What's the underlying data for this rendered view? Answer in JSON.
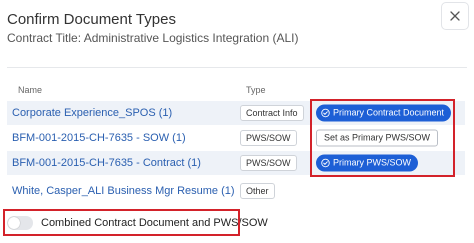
{
  "dialog": {
    "title": "Confirm Document Types",
    "subtitle": "Contract Title: Administrative Logistics Integration (ALI)",
    "close_icon": "close-icon"
  },
  "table": {
    "columns": {
      "name": "Name",
      "type": "Type"
    },
    "rows": [
      {
        "name": "Corporate Experience_SPOS (1)",
        "type": "Contract Info",
        "action": "Primary Contract Document",
        "action_style": "primary-selected"
      },
      {
        "name": "BFM-001-2015-CH-7635 - SOW (1)",
        "type": "PWS/SOW",
        "action": "Set as Primary PWS/SOW",
        "action_style": "button"
      },
      {
        "name": "BFM-001-2015-CH-7635 - Contract (1)",
        "type": "PWS/SOW",
        "action": "Primary PWS/SOW",
        "action_style": "primary-selected"
      },
      {
        "name": "White, Casper_ALI Business Mgr Resume (1)",
        "type": "Other",
        "action": "",
        "action_style": "none"
      }
    ]
  },
  "toggle": {
    "label": "Combined Contract Document and PWS/SOW",
    "checked": false
  },
  "colors": {
    "link": "#2a5fb0",
    "primary": "#1d5fd6",
    "highlight_box": "#d3222a",
    "row_alt": "#eef2f8"
  }
}
